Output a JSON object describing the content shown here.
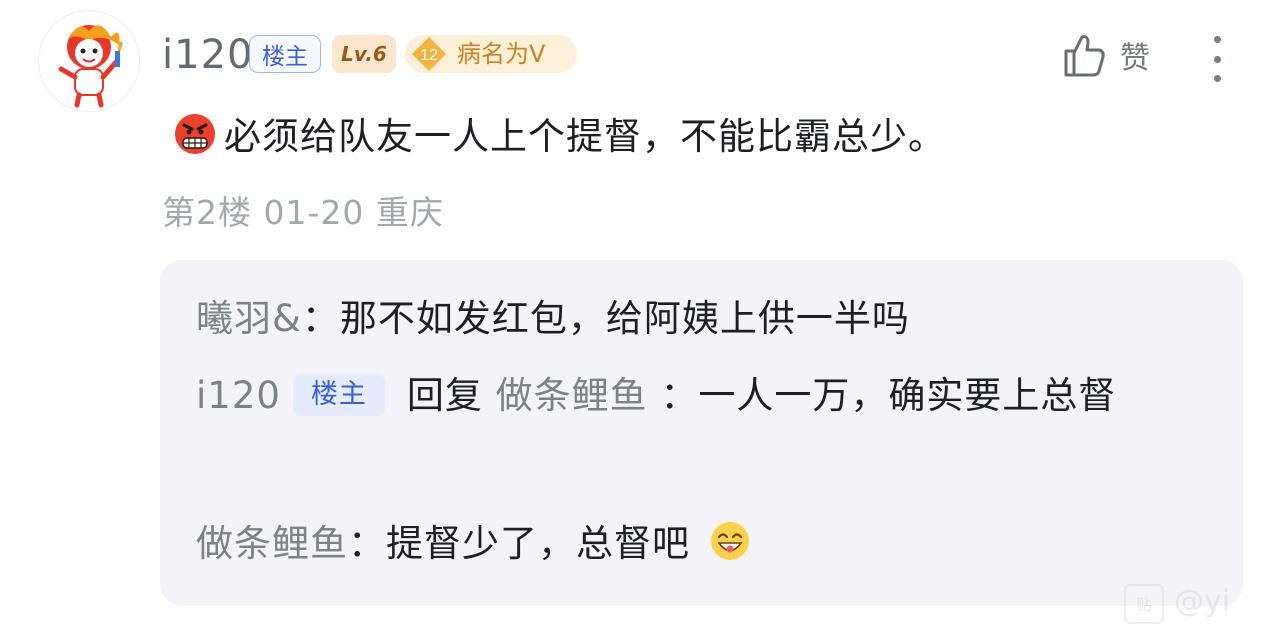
{
  "post": {
    "username": "i120",
    "op_badge": "楼主",
    "level": "Lv.6",
    "fan_level": "12",
    "fan_title": "病名为V",
    "like_label": "赞",
    "content": "必须给队友一人上个提督，不能比霸总少。",
    "floor": "第2楼",
    "date": "01-20",
    "location": "重庆"
  },
  "replies": [
    {
      "user": "曦羽&",
      "sep": "：",
      "text": "那不如发红包，给阿姨上供一半吗"
    },
    {
      "user": "i120",
      "badge": "楼主",
      "reply_word": "回复",
      "reply_to": "做条鲤鱼",
      "text": "：一人一万，确实要上总督"
    },
    {
      "user": "做条鲤鱼",
      "sep": "：",
      "text": "提督少了，总督吧"
    }
  ],
  "watermark": {
    "logo": "贴",
    "text": "@yi"
  },
  "colors": {
    "accent": "#3a5fd8",
    "reply_bg": "#f4f4f8",
    "fan_gold": "#c88420"
  },
  "icons": {
    "like": "thumbs-up-icon",
    "more": "vertical-ellipsis-icon",
    "angry_emoji": "angry-face-emoji",
    "laugh_emoji": "laughing-face-emoji"
  }
}
